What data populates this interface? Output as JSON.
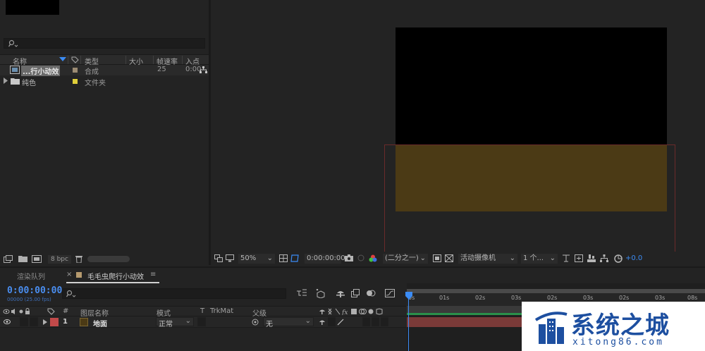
{
  "project_panel": {
    "search_placeholder": "",
    "columns": [
      "名称",
      "类型",
      "大小",
      "帧速率",
      "入点"
    ],
    "items": [
      {
        "name": "...行小动效",
        "type": "合成",
        "size": "",
        "fps": "25",
        "in_point": "0:00",
        "label_color": "#9c8b73"
      },
      {
        "name": "纯色",
        "type": "文件夹",
        "size": "",
        "fps": "",
        "in_point": "",
        "label_color": "#e0cf3a"
      }
    ],
    "footer": {
      "bpc": "8 bpc"
    }
  },
  "viewer_toolbar": {
    "zoom": "50%",
    "timecode": "0:00:00:00",
    "resolution": "(二分之一)",
    "camera": "活动摄像机",
    "views": "1 个...",
    "exposure": "+0.0"
  },
  "timeline": {
    "tabs": {
      "render_queue": "渲染队列",
      "close": "×",
      "comp_name": "毛毛虫爬行小动效",
      "menu": "≡"
    },
    "timecode": "0:00:00:00",
    "frames": "00000 (25.00 fps)",
    "columns": {
      "number": "#",
      "layer_name": "图层名称",
      "mode": "模式",
      "t": "T",
      "trkmat": "TrkMat",
      "parent": "父级"
    },
    "layer": {
      "index": "1",
      "name": "地面",
      "mode": "正常",
      "parent": "无",
      "label_color": "#c24a4a",
      "swatch_color": "#4b3a15"
    },
    "ruler_ticks": [
      "0s",
      "01s",
      "02s",
      "03s",
      "02s",
      "03s",
      "02s",
      "03s",
      "08s"
    ]
  },
  "watermark": {
    "text": "系统之城",
    "url": "xitong86.com"
  },
  "colors": {
    "accent": "#3b8cf5",
    "layer_bar": "#7a3a38",
    "comp_brown": "#4b3a15"
  }
}
